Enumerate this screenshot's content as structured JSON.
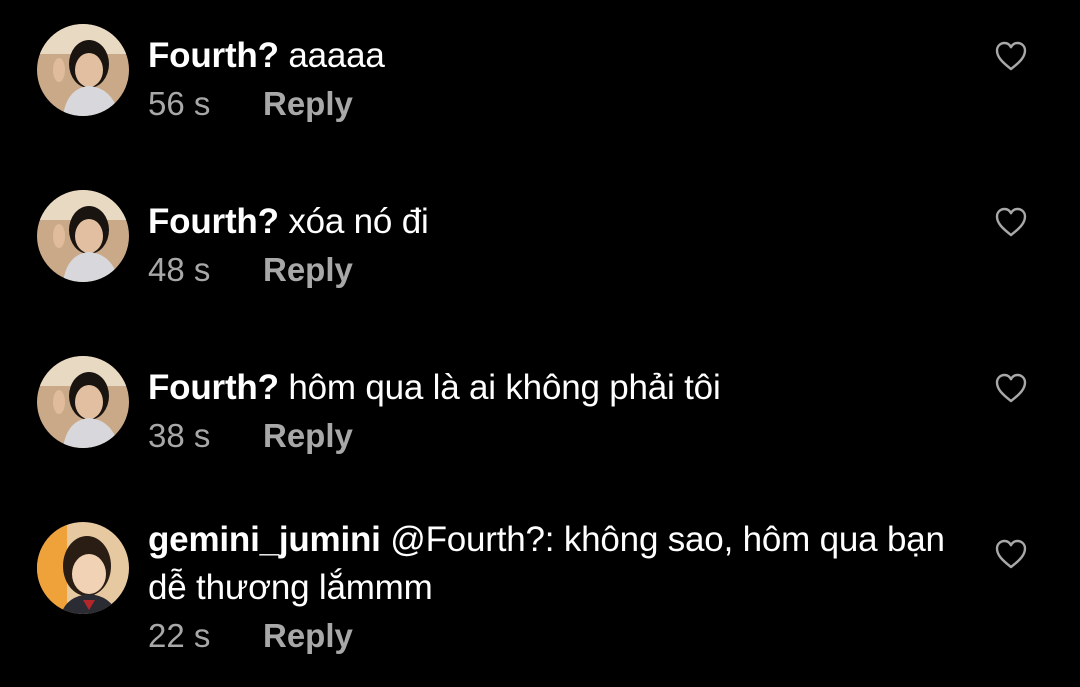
{
  "comments": [
    {
      "username": "Fourth?",
      "text": "aaaaa",
      "time": "56 s",
      "reply_label": "Reply",
      "avatar_icon": "user-photo-avatar",
      "like_icon": "heart-outline-icon"
    },
    {
      "username": "Fourth?",
      "text": "xóa nó đi",
      "time": "48 s",
      "reply_label": "Reply",
      "avatar_icon": "user-photo-avatar",
      "like_icon": "heart-outline-icon"
    },
    {
      "username": "Fourth?",
      "text": "hôm qua là ai không phải tôi",
      "time": "38 s",
      "reply_label": "Reply",
      "avatar_icon": "user-photo-avatar",
      "like_icon": "heart-outline-icon"
    },
    {
      "username": "gemini_jumini",
      "text": "@Fourth?: không sao, hôm qua bạn dễ thương lắmmm",
      "time": "22 s",
      "reply_label": "Reply",
      "avatar_icon": "user-photo-avatar",
      "like_icon": "heart-outline-icon"
    }
  ],
  "colors": {
    "background": "#000000",
    "primary_text": "#ffffff",
    "secondary_text": "#a8a8a8"
  }
}
